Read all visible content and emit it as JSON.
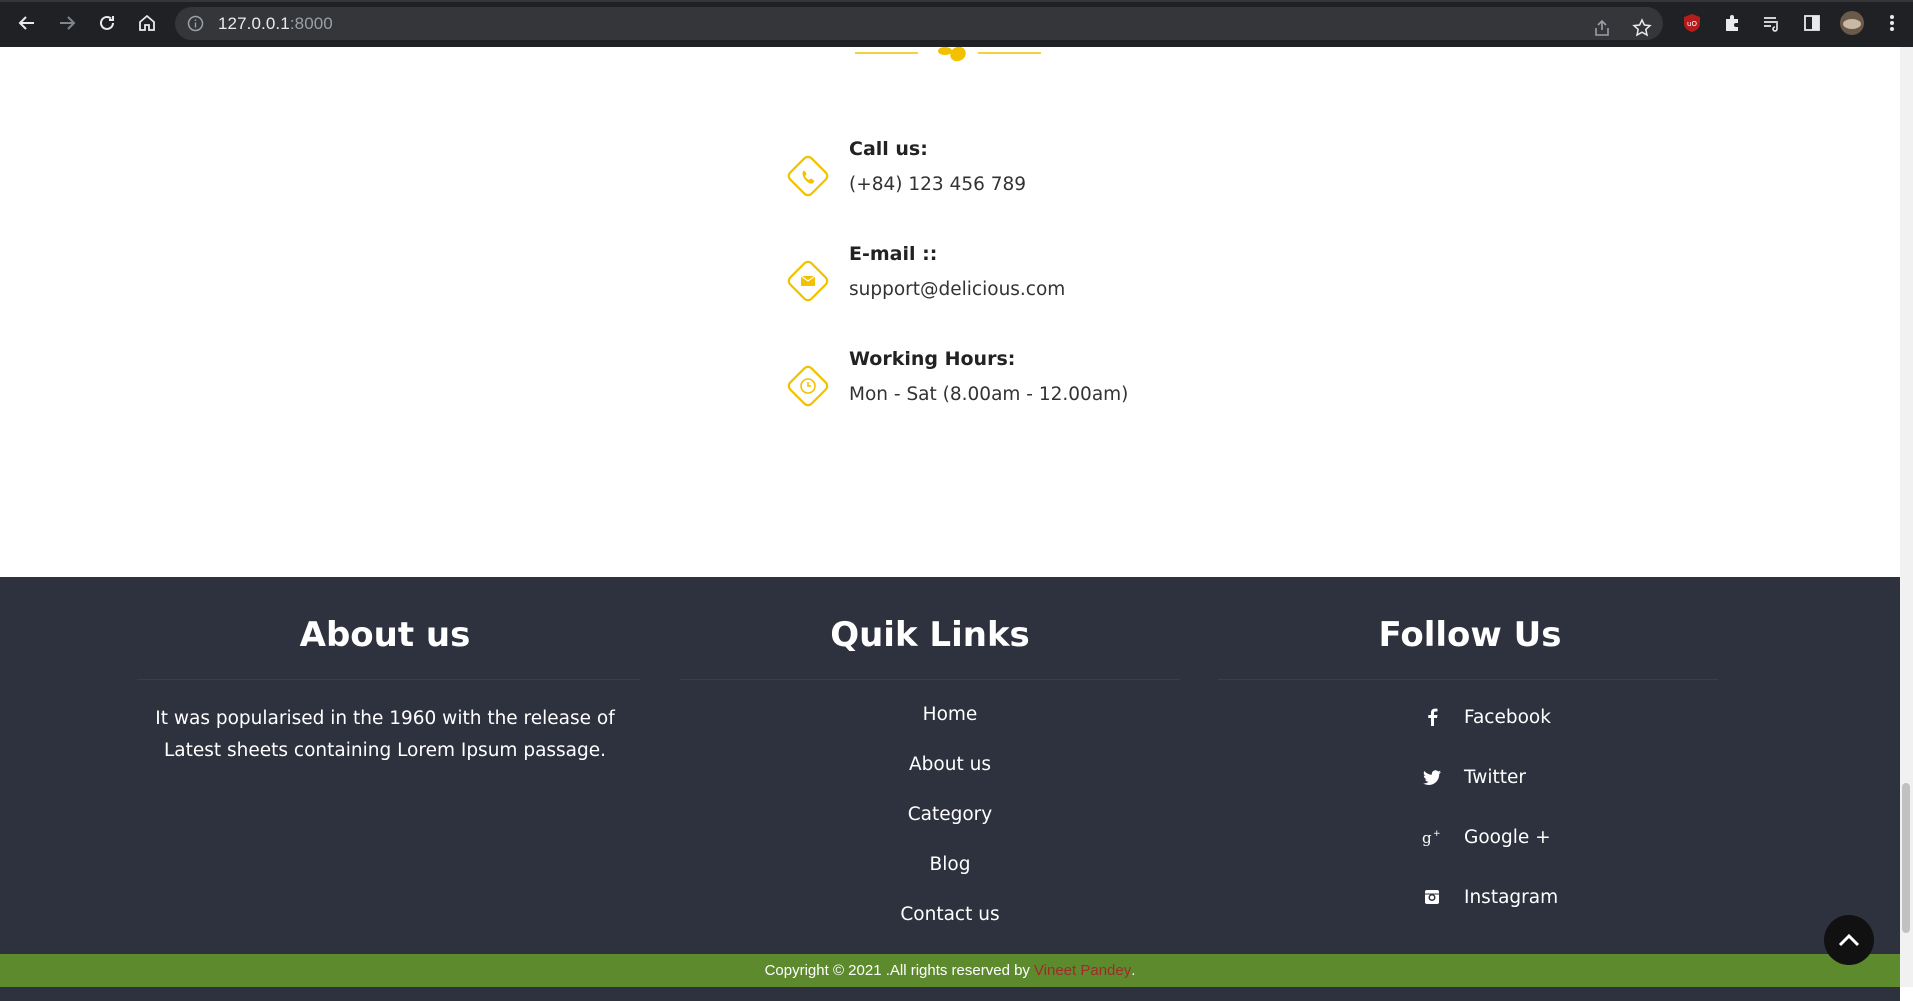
{
  "browser": {
    "url_host": "127.0.0.1",
    "url_port": ":8000"
  },
  "contact": {
    "items": [
      {
        "label": "Call us:",
        "value": "(+84) 123 456 789",
        "icon": "phone-icon"
      },
      {
        "label": "E-mail ::",
        "value": "support@delicious.com",
        "icon": "envelope-icon"
      },
      {
        "label": "Working Hours:",
        "value": "Mon - Sat (8.00am - 12.00am)",
        "icon": "clock-icon"
      }
    ]
  },
  "footer": {
    "about": {
      "title": "About us",
      "text": "It was popularised in the 1960 with the release of Latest sheets containing Lorem Ipsum passage."
    },
    "quick_links": {
      "title": "Quik Links",
      "items": [
        "Home",
        "About us",
        "Category",
        "Blog",
        "Contact us"
      ]
    },
    "follow": {
      "title": "Follow Us",
      "items": [
        {
          "label": "Facebook",
          "icon": "facebook-icon"
        },
        {
          "label": "Twitter",
          "icon": "twitter-icon"
        },
        {
          "label": "Google +",
          "icon": "google-plus-icon"
        },
        {
          "label": "Instagram",
          "icon": "instagram-icon"
        }
      ]
    }
  },
  "copyright": {
    "text": "Copyright © 2021 .All rights reserved by",
    "author": "Vineet Pandey",
    "suffix": "."
  },
  "colors": {
    "accent": "#f2c200",
    "footer_bg": "#2d323e",
    "copyright_bg": "#5e8a2e",
    "rule": "#7a2133",
    "author": "#a12b2b"
  }
}
